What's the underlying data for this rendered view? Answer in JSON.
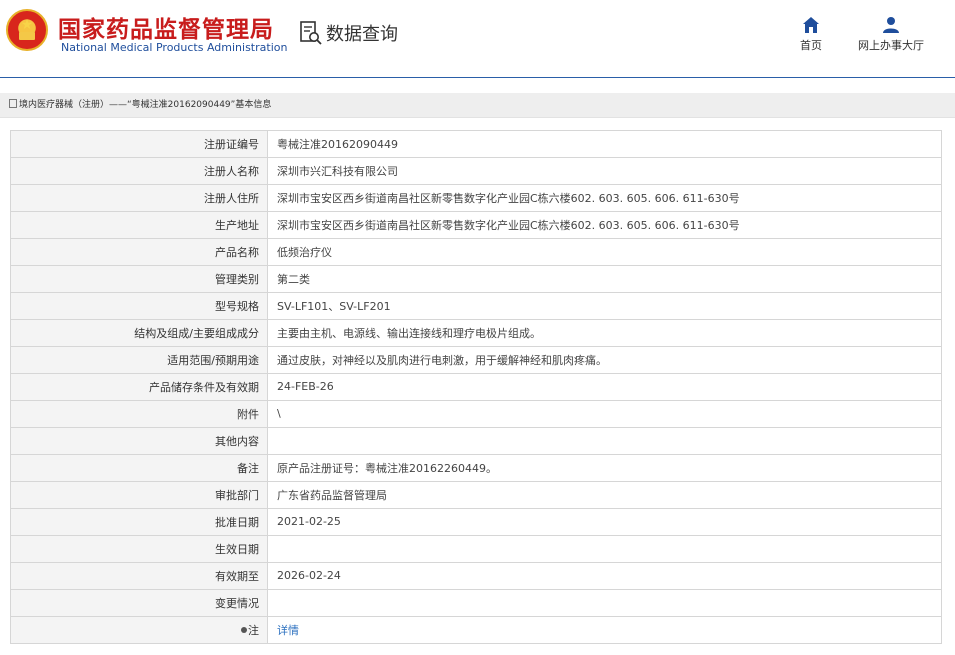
{
  "header": {
    "title_cn": "国家药品监督管理局",
    "title_en": "National Medical Products Administration",
    "data_query": "数据查询",
    "nav": {
      "home": "首页",
      "online_hall": "网上办事大厅"
    }
  },
  "breadcrumb": "境内医疗器械（注册）——“粤械注准20162090449”基本信息",
  "rows": [
    {
      "label": "注册证编号",
      "value": "粤械注准20162090449"
    },
    {
      "label": "注册人名称",
      "value": "深圳市兴汇科技有限公司"
    },
    {
      "label": "注册人住所",
      "value": "深圳市宝安区西乡街道南昌社区新零售数字化产业园C栋六楼602. 603. 605. 606. 611-630号"
    },
    {
      "label": "生产地址",
      "value": "深圳市宝安区西乡街道南昌社区新零售数字化产业园C栋六楼602. 603. 605. 606. 611-630号"
    },
    {
      "label": "产品名称",
      "value": "低频治疗仪"
    },
    {
      "label": "管理类别",
      "value": "第二类"
    },
    {
      "label": "型号规格",
      "value": "SV-LF101、SV-LF201"
    },
    {
      "label": "结构及组成/主要组成成分",
      "value": "主要由主机、电源线、输出连接线和理疗电极片组成。"
    },
    {
      "label": "适用范围/预期用途",
      "value": "通过皮肤，对神经以及肌肉进行电刺激，用于缓解神经和肌肉疼痛。"
    },
    {
      "label": "产品储存条件及有效期",
      "value": "24-FEB-26"
    },
    {
      "label": "附件",
      "value": "\\"
    },
    {
      "label": "其他内容",
      "value": ""
    },
    {
      "label": "备注",
      "value": "原产品注册证号：粤械注准20162260449。"
    },
    {
      "label": "审批部门",
      "value": "广东省药品监督管理局"
    },
    {
      "label": "批准日期",
      "value": "2021-02-25"
    },
    {
      "label": "生效日期",
      "value": ""
    },
    {
      "label": "有效期至",
      "value": "2026-02-24"
    },
    {
      "label": "变更情况",
      "value": ""
    }
  ],
  "note": {
    "label": "注",
    "link": "详情"
  }
}
